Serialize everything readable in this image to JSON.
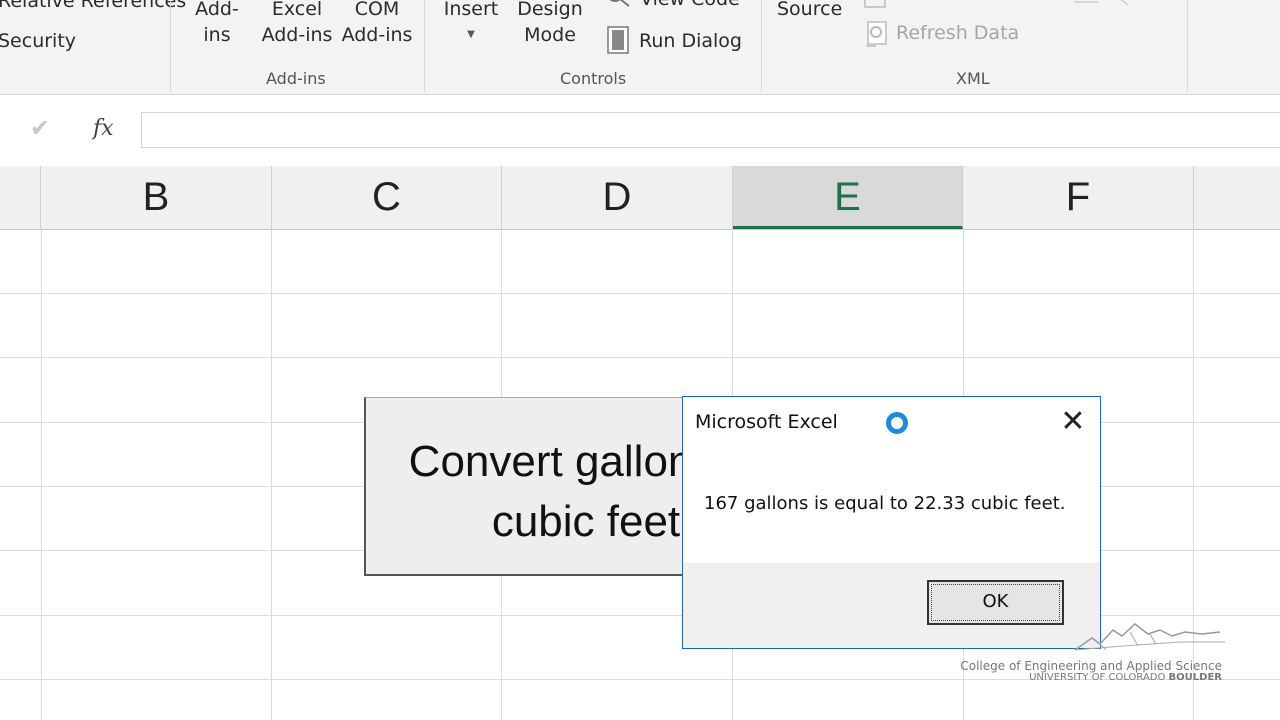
{
  "ribbon": {
    "left_top": "Relative References",
    "security": "Security",
    "addins_btn_line1": "Add-",
    "addins_btn_line2": "ins",
    "excel_addins_line1": "Excel",
    "excel_addins_line2": "Add-ins",
    "com_addins_line1": "COM",
    "com_addins_line2": "Add-ins",
    "group_addins": "Add-ins",
    "insert": "Insert",
    "design_mode_line1": "Design",
    "design_mode_line2": "Mode",
    "view_code": "View Code",
    "run_dialog": "Run Dialog",
    "group_controls": "Controls",
    "source": "Source",
    "refresh_data": "Refresh Data",
    "group_xml": "XML"
  },
  "formula_bar": {
    "check_symbol": "✔",
    "fx_label": "fx",
    "value": ""
  },
  "columns": [
    "B",
    "C",
    "D",
    "E",
    "F"
  ],
  "selected_column": "E",
  "shape": {
    "line1": "Convert gallons to",
    "line2": "cubic feet"
  },
  "dialog": {
    "title": "Microsoft Excel",
    "close_symbol": "✕",
    "message": "167 gallons is equal to 22.33 cubic feet.",
    "ok_label": "OK"
  },
  "watermark": {
    "line1": "College of Engineering and Applied Science",
    "line2_part1": "UNIVERSITY OF COLORADO ",
    "line2_part2": "BOULDER"
  },
  "colors": {
    "accent_green": "#1e7145",
    "dialog_border": "#1a67b6",
    "spinner": "#1f8ad8"
  }
}
